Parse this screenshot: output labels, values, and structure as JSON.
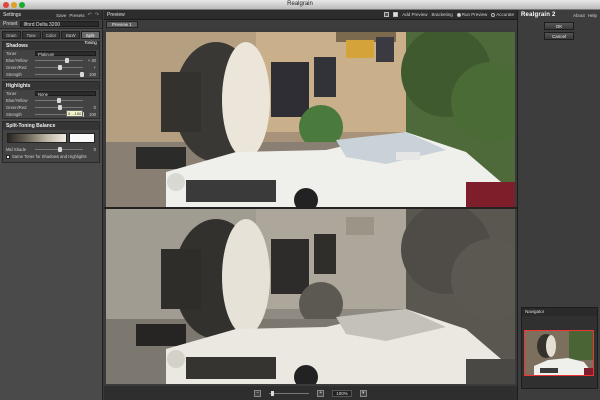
{
  "window": {
    "title": "Realgrain"
  },
  "settings_panel": {
    "title": "Settings",
    "save_label": "Save",
    "presets_label": "Presets",
    "preset_label": "Preset",
    "preset_value": "Ilford Delta 3200",
    "tabs": [
      "Grain",
      "Tone",
      "Color",
      "B&W",
      "Split-Toning"
    ],
    "shadows": {
      "title": "Shadows",
      "toner_label": "Toner",
      "toner_value": "Platinum",
      "blue_yellow_label": "Blue/Yellow",
      "blue_yellow_value": "+ 30",
      "green_red_label": "Green/Red",
      "green_red_value": "+",
      "strength_label": "Strength",
      "strength_value": "100"
    },
    "highlights": {
      "title": "Highlights",
      "toner_label": "Toner",
      "toner_value": "None",
      "blue_yellow_label": "Blue/Yellow",
      "green_red_label": "Green/Red",
      "green_red_value": "0",
      "strength_label": "Strength",
      "strength_value": "100"
    },
    "tooltip": "0 ...100",
    "balance": {
      "title": "Split-Toning Balance",
      "mid_shade_label": "Mid Shade",
      "mid_shade_value": "0",
      "same_toner_label": "Same Toner for Shadows and Highlights"
    }
  },
  "preview": {
    "title": "Preview",
    "add_preview": "Add Preview",
    "bracketing": "Bracketing",
    "run_preview": "Run Preview",
    "accurate": "Accurate",
    "tab": "Preview 1",
    "zoom_value": "100%",
    "zoom_minus": "−",
    "zoom_plus": "+"
  },
  "right_panel": {
    "brand": "Realgrain 2",
    "about": "About",
    "help": "Help",
    "ok": "OK",
    "cancel": "Cancel",
    "navigator_title": "Navigator"
  },
  "colors": {
    "panel_bg": "#4a4a4a",
    "toolbar_bg": "#2c2c2c",
    "navigator_frame": "#e33333"
  },
  "icons": [
    "undo-icon",
    "redo-icon",
    "single-view-icon",
    "split-view-icon",
    "zoom-out-icon",
    "zoom-in-icon",
    "zoom-dropdown-icon"
  ]
}
